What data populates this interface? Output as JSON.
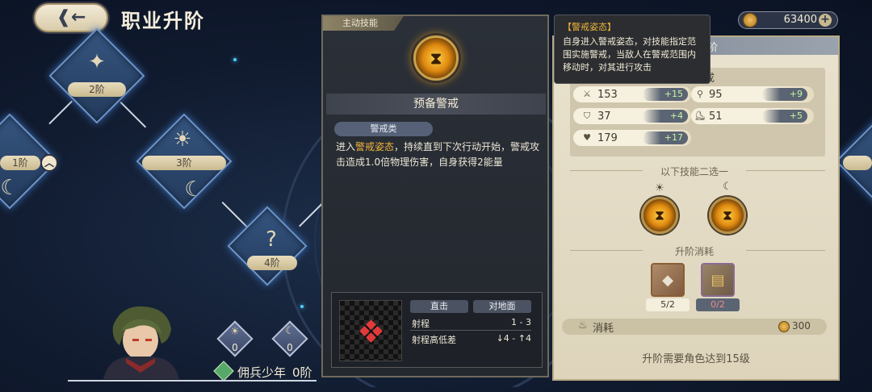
{
  "header": {
    "title": "职业升阶",
    "back_icon": "back-arrow-icon"
  },
  "currency": {
    "value": "63400",
    "plus": "+"
  },
  "tiers": [
    {
      "label": "2阶",
      "icon": "compass-star-icon"
    },
    {
      "label": "1阶",
      "icon": "sun-moon-icon"
    },
    {
      "label": "3阶",
      "icon": "sun-moon-icon"
    },
    {
      "label": "4阶",
      "icon": "question-icon"
    }
  ],
  "character": {
    "name": "佣兵少年",
    "rank": "0阶",
    "sun_value": "0",
    "moon_value": "0"
  },
  "skill_panel": {
    "tag": "主动技能",
    "name": "预备警戒",
    "type": "警戒类",
    "desc_pre": "进入",
    "desc_highlight": "警戒姿态",
    "desc_post": "，持续直到下次行动开始，警戒攻击造成1.0倍物理伤害，自身获得2能量",
    "range": {
      "header_attack": "直击",
      "header_target": "对地面",
      "range_label": "射程",
      "range_value": "1 - 3",
      "height_label": "射程高低差",
      "height_value": "↓4 - ↑4"
    }
  },
  "tooltip": {
    "title": "【警戒姿态】",
    "body": "自身进入警戒姿态，对技能指定范围实施警戒，当敌人在警戒范围内移动时，对其进行攻击"
  },
  "right_panel": {
    "header": "阶",
    "stats_heading": "戒",
    "stats": [
      {
        "icon": "sword-icon",
        "value": "153",
        "bonus": "+15"
      },
      {
        "icon": "staff-icon",
        "value": "95",
        "bonus": "+9"
      },
      {
        "icon": "shield-icon",
        "value": "37",
        "bonus": "+4"
      },
      {
        "icon": "boot-icon",
        "value": "51",
        "bonus": "+5"
      },
      {
        "icon": "heart-icon",
        "value": "179",
        "bonus": "+17"
      }
    ],
    "choose_title": "以下技能二选一",
    "cost_title": "升阶消耗",
    "items": [
      {
        "count": "5/2",
        "icon": "crystal-shard-icon"
      },
      {
        "count": "0/2",
        "icon": "gold-book-icon"
      }
    ],
    "cost_label": "消耗",
    "cost_value": "300",
    "requirement": "升阶需要角色达到15级"
  }
}
